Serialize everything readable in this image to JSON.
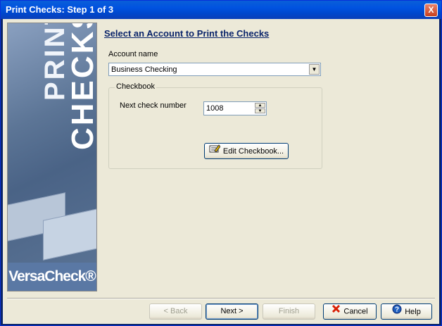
{
  "window": {
    "title": "Print Checks: Step 1 of 3",
    "close_glyph": "X"
  },
  "sidebar": {
    "line1": "PRINT",
    "line2": "CHECKS",
    "logo": "VersaCheck®"
  },
  "main": {
    "heading": "Select an Account to Print the Checks",
    "account_label": "Account name",
    "account_value": "Business Checking",
    "group_label": "Checkbook",
    "next_check_label": "Next check number",
    "next_check_value": "1008",
    "edit_button": "Edit Checkbook..."
  },
  "footer": {
    "back": "< Back",
    "next": "Next >",
    "finish": "Finish",
    "cancel": "Cancel",
    "help": "Help"
  },
  "icons": {
    "edit": "pencil-checkbook-icon",
    "cancel": "red-x-icon",
    "help": "question-icon"
  }
}
